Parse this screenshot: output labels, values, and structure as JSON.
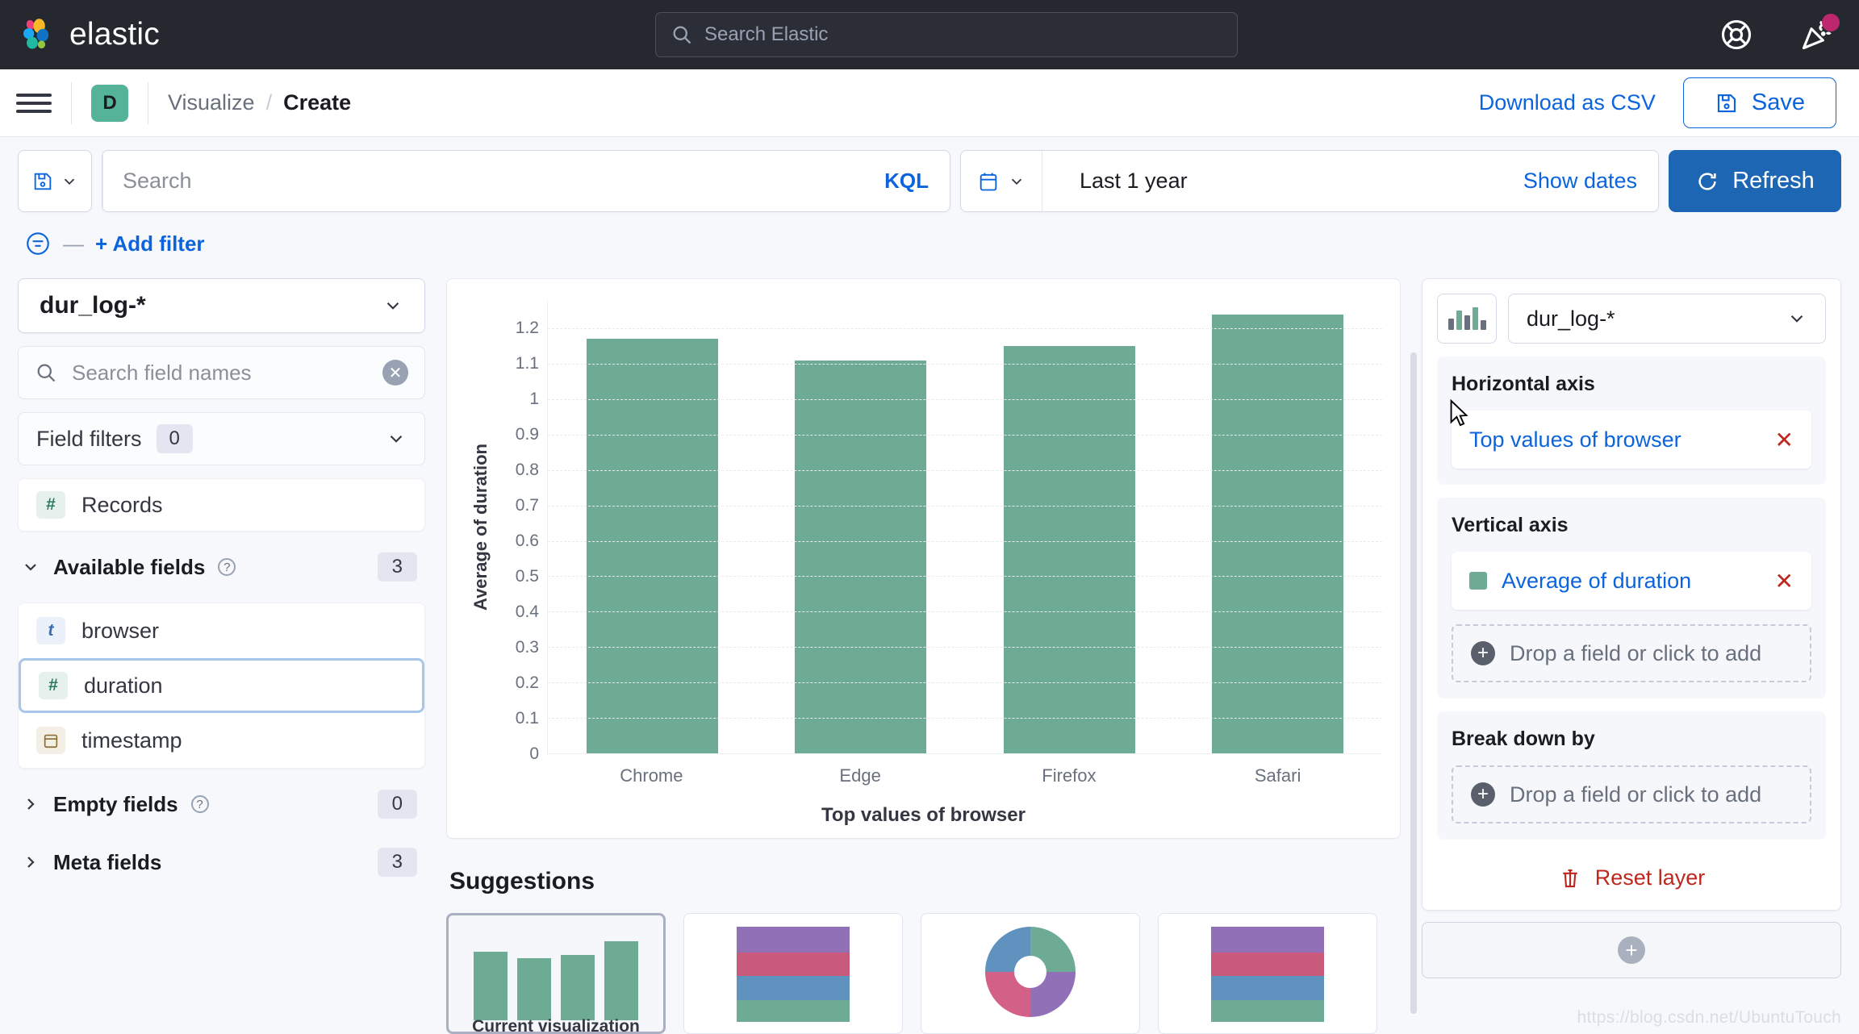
{
  "topbar": {
    "brand": "elastic",
    "search_placeholder": "Search Elastic",
    "help_icon": "lifebuoy-icon",
    "news_icon": "party-popper-icon"
  },
  "header": {
    "menu_icon": "hamburger-menu-icon",
    "space_badge": "D",
    "breadcrumbs": [
      {
        "label": "Visualize",
        "current": false
      },
      {
        "label": "Create",
        "current": true
      }
    ],
    "separator": "/",
    "download_csv_label": "Download as CSV",
    "save_label": "Save",
    "save_icon": "save-disk-icon"
  },
  "querybar": {
    "saved_query_icon": "save-disk-icon",
    "search_placeholder": "Search",
    "language_label": "KQL",
    "date_icon": "calendar-icon",
    "date_range": "Last 1 year",
    "show_dates_label": "Show dates",
    "refresh_label": "Refresh",
    "refresh_icon": "refresh-icon",
    "filter_icon": "filter-icon",
    "filter_dash": "—",
    "add_filter_label": "+ Add filter"
  },
  "fieldpanel": {
    "data_view": "dur_log-*",
    "search_placeholder": "Search field names",
    "search_icon": "search-icon",
    "clear_icon": "clear-icon",
    "field_filters_label": "Field filters",
    "field_filters_count": "0",
    "records": {
      "label": "Records",
      "type": "number",
      "type_glyph": "#"
    },
    "available": {
      "label": "Available fields",
      "count": "3",
      "expanded": true,
      "fields": [
        {
          "label": "browser",
          "type": "string",
          "type_glyph": "t",
          "selected": false
        },
        {
          "label": "duration",
          "type": "number",
          "type_glyph": "#",
          "selected": true
        },
        {
          "label": "timestamp",
          "type": "date",
          "type_glyph": "calendar",
          "selected": false
        }
      ]
    },
    "empty": {
      "label": "Empty fields",
      "count": "0",
      "expanded": false
    },
    "meta": {
      "label": "Meta fields",
      "count": "3",
      "expanded": false
    }
  },
  "chart_data": {
    "type": "bar",
    "title": "",
    "categories": [
      "Chrome",
      "Edge",
      "Firefox",
      "Safari"
    ],
    "values": [
      1.17,
      1.11,
      1.15,
      1.24
    ],
    "series": [
      {
        "name": "Average of duration",
        "values": [
          1.17,
          1.11,
          1.15,
          1.24
        ]
      }
    ],
    "xlabel": "Top values of browser",
    "ylabel": "Average of duration",
    "ylim": [
      0,
      1.28
    ],
    "yticks": [
      "0",
      "0.1",
      "0.2",
      "0.3",
      "0.4",
      "0.5",
      "0.6",
      "0.7",
      "0.8",
      "0.9",
      "1",
      "1.1",
      "1.2"
    ],
    "ytick_values": [
      0,
      0.1,
      0.2,
      0.3,
      0.4,
      0.5,
      0.6,
      0.7,
      0.8,
      0.9,
      1.0,
      1.1,
      1.2
    ],
    "grid": true,
    "legend": "none",
    "bar_color": "#6dab94"
  },
  "suggestions": {
    "title": "Suggestions",
    "items": [
      {
        "kind": "bar",
        "label": "Current visualization",
        "active": true,
        "bars": [
          82,
          74,
          78,
          94
        ],
        "color": "#6dab94"
      },
      {
        "kind": "stacked-bar",
        "label": "",
        "active": false,
        "stack": [
          {
            "color": "#9170b8",
            "pct": 27
          },
          {
            "color": "#c85a7c",
            "pct": 25
          },
          {
            "color": "#6092c0",
            "pct": 25
          },
          {
            "color": "#6dab94",
            "pct": 23
          }
        ]
      },
      {
        "kind": "donut",
        "label": "",
        "active": false,
        "slices": [
          {
            "color": "#6dab94",
            "pct": 25
          },
          {
            "color": "#9170b8",
            "pct": 25
          },
          {
            "color": "#d36086",
            "pct": 25
          },
          {
            "color": "#6092c0",
            "pct": 25
          }
        ]
      },
      {
        "kind": "stacked-bar",
        "label": "",
        "active": false,
        "stack": [
          {
            "color": "#9170b8",
            "pct": 27
          },
          {
            "color": "#c85a7c",
            "pct": 25
          },
          {
            "color": "#6092c0",
            "pct": 25
          },
          {
            "color": "#6dab94",
            "pct": 23
          }
        ]
      }
    ]
  },
  "config": {
    "chart_type_icon": "bar-chart-icon",
    "data_view": "dur_log-*",
    "horizontal_axis": {
      "title": "Horizontal axis",
      "dimension": "Top values of browser",
      "remove_icon": "close-icon"
    },
    "vertical_axis": {
      "title": "Vertical axis",
      "dimension": "Average of duration",
      "color": "#6dab94",
      "remove_icon": "close-icon",
      "dropzone": "Drop a field or click to add"
    },
    "break_down_by": {
      "title": "Break down by",
      "dropzone": "Drop a field or click to add"
    },
    "reset_layer_label": "Reset layer",
    "reset_layer_icon": "trash-icon",
    "add_layer_icon": "plus-icon"
  },
  "watermark": "https://blog.csdn.net/UbuntuTouch"
}
